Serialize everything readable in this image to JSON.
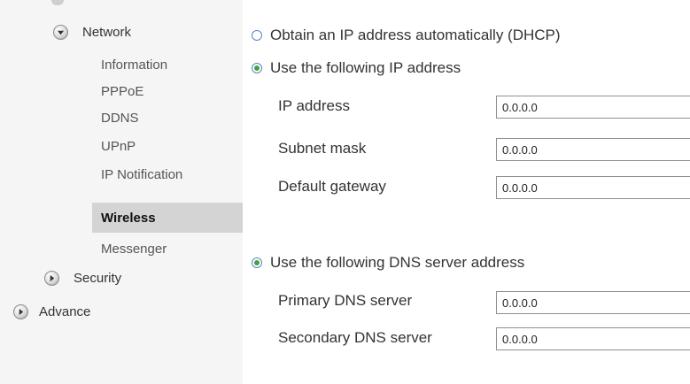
{
  "sidebar": {
    "network": {
      "label": "Network",
      "icon": "chevron-down-icon"
    },
    "network_items": [
      {
        "label": "Information",
        "active": false
      },
      {
        "label": "PPPoE",
        "active": false
      },
      {
        "label": "DDNS",
        "active": false
      },
      {
        "label": "UPnP",
        "active": false
      },
      {
        "label": "IP Notification",
        "active": false
      },
      {
        "label": "Wireless",
        "active": true
      },
      {
        "label": "Messenger",
        "active": false
      }
    ],
    "security": {
      "label": "Security",
      "icon": "chevron-right-icon"
    },
    "advance": {
      "label": "Advance",
      "icon": "chevron-right-icon"
    }
  },
  "ip_mode": {
    "dhcp_label": "Obtain an IP address automatically (DHCP)",
    "dhcp_checked": false,
    "static_label": "Use the following IP address",
    "static_checked": true
  },
  "ip_fields": {
    "ip_address": {
      "label": "IP address",
      "value": "0.0.0.0"
    },
    "subnet_mask": {
      "label": "Subnet mask",
      "value": "0.0.0.0"
    },
    "default_gateway": {
      "label": "Default gateway",
      "value": "0.0.0.0"
    }
  },
  "dns": {
    "label": "Use the following DNS server address",
    "checked": true,
    "primary": {
      "label": "Primary DNS server",
      "value": "0.0.0.0"
    },
    "secondary": {
      "label": "Secondary DNS server",
      "value": "0.0.0.0"
    }
  },
  "colors": {
    "sidebar_bg": "#f5f5f5",
    "active_item_bg": "#d4d4d4",
    "radio_border": "#5a84c4",
    "radio_dot": "#3fa33f"
  }
}
